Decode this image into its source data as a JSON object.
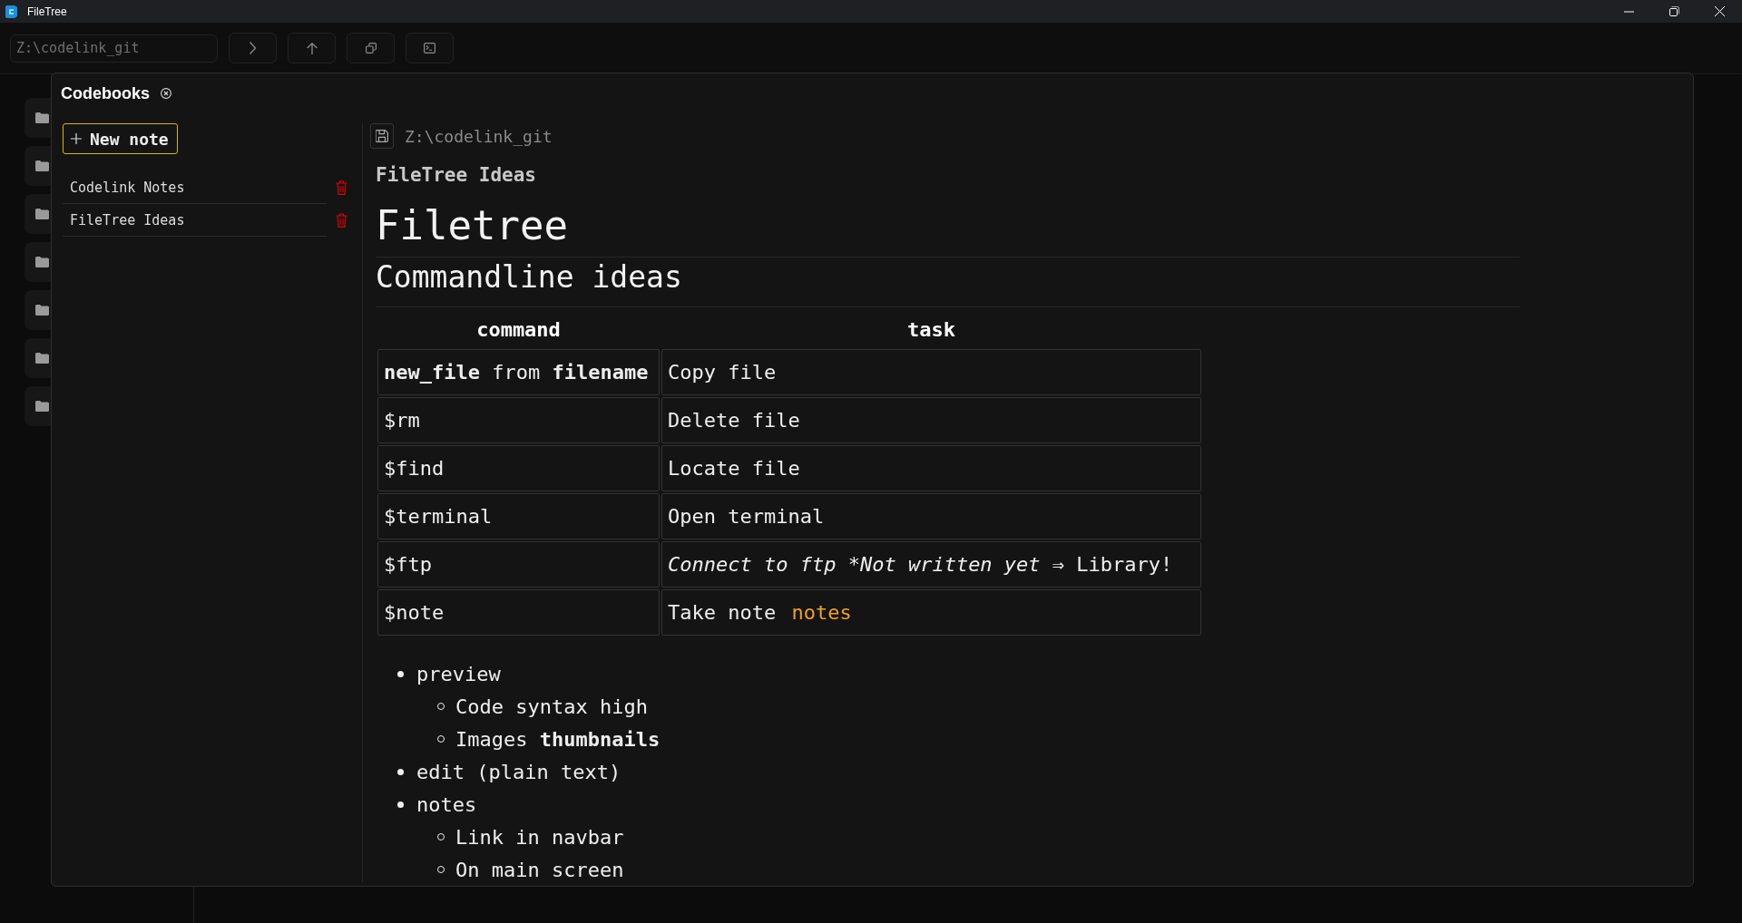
{
  "window": {
    "title": "FileTree"
  },
  "toolbar": {
    "path": "Z:\\codelink_git"
  },
  "sidebar": {
    "items": [
      {
        "kind": "folder"
      },
      {
        "kind": "folder"
      },
      {
        "kind": "folder"
      },
      {
        "kind": "folder"
      },
      {
        "kind": "folder"
      },
      {
        "kind": "folder"
      },
      {
        "kind": "folder"
      }
    ]
  },
  "codebooks": {
    "title": "Codebooks",
    "new_note": "New note",
    "notes": [
      {
        "title": "Codelink Notes"
      },
      {
        "title": "FileTree Ideas"
      }
    ]
  },
  "note": {
    "path": "Z:\\codelink_git",
    "title": "FileTree Ideas",
    "heading": "Filetree",
    "subheading": "Commandline ideas",
    "table": {
      "columns": [
        "command",
        "task"
      ],
      "rows": [
        {
          "cells": [
            [
              {
                "text": "new_file",
                "kind": "bold"
              },
              {
                "text": " from ",
                "kind": "plain"
              },
              {
                "text": "filename",
                "kind": "bold"
              }
            ],
            [
              {
                "text": "Copy file",
                "kind": "plain"
              }
            ]
          ]
        },
        {
          "cells": [
            [
              {
                "text": "$rm",
                "kind": "plain"
              }
            ],
            [
              {
                "text": "Delete file",
                "kind": "plain"
              }
            ]
          ]
        },
        {
          "cells": [
            [
              {
                "text": "$find",
                "kind": "plain"
              }
            ],
            [
              {
                "text": "Locate file",
                "kind": "plain"
              }
            ]
          ]
        },
        {
          "cells": [
            [
              {
                "text": "$terminal",
                "kind": "plain"
              }
            ],
            [
              {
                "text": "Open terminal",
                "kind": "plain"
              }
            ]
          ]
        },
        {
          "cells": [
            [
              {
                "text": "$ftp",
                "kind": "plain"
              }
            ],
            [
              {
                "text": "Connect to ftp *Not written yet",
                "kind": "italic"
              },
              {
                "text": " ⇒ Library!",
                "kind": "plain"
              }
            ]
          ]
        },
        {
          "cells": [
            [
              {
                "text": "$note",
                "kind": "plain"
              }
            ],
            [
              {
                "text": "Take note ",
                "kind": "plain"
              },
              {
                "text": "notes",
                "kind": "link"
              }
            ]
          ]
        }
      ]
    },
    "list": [
      {
        "text": "preview",
        "children": [
          {
            "text": "Code syntax high"
          },
          {
            "text": "Images **thumbnails**"
          }
        ]
      },
      {
        "text": "edit (plain text)"
      },
      {
        "text": "notes",
        "children": [
          {
            "text": "Link in navbar"
          },
          {
            "text": "On main screen"
          }
        ]
      }
    ]
  }
}
